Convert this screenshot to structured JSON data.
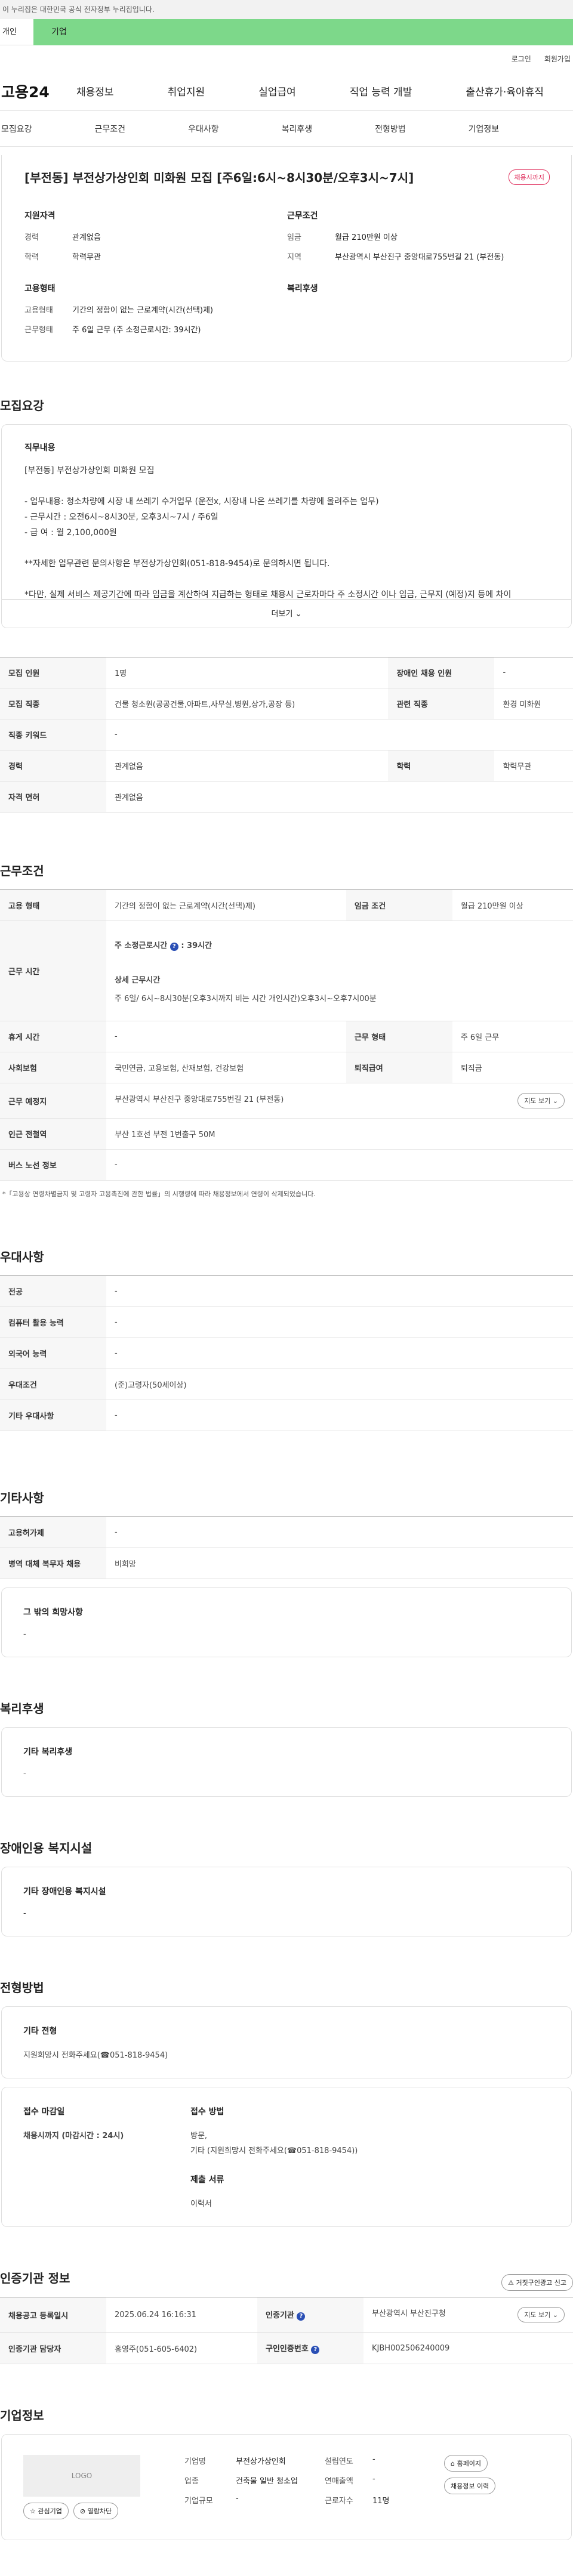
{
  "gov_notice": "이 누리집은 대한민국 공식 전자정부 누리집입니다.",
  "top_tabs": {
    "individual": "개인",
    "company": "기업"
  },
  "util": {
    "login": "로그인",
    "join": "회원가입"
  },
  "logo": "고용24",
  "gnb": [
    "채용정보",
    "취업지원",
    "실업급여",
    "직업 능력 개발",
    "출산휴가·육아휴직"
  ],
  "snb": [
    "모집요강",
    "근무조건",
    "우대사항",
    "복리후생",
    "전형방법",
    "기업정보"
  ],
  "job": {
    "title": "[부전동] 부전상가상인회 미화원 모집 [주6일:6시~8시30분/오후3시~7시]",
    "badge": "채용시까지",
    "qual_title": "지원자격",
    "career_k": "경력",
    "career_v": "관계없음",
    "edu_k": "학력",
    "edu_v": "학력무관",
    "cond_title": "근무조건",
    "wage_k": "임금",
    "wage_v": "월급 210만원 이상",
    "area_k": "지역",
    "area_v": "부산광역시 부산진구 중앙대로755번길 21 (부전동)",
    "emp_title": "고용형태",
    "type_k": "고용형태",
    "type_v": "기간의 정함이 없는 근로계약(시간(선택)제)",
    "form_k": "근무형태",
    "form_v": "주 6일 근무 (주 소정근로시간: 39시간)",
    "welfare_title": "복리후생"
  },
  "recruit": {
    "section_title": "모집요강",
    "desc_label": "직무내용",
    "desc": "[부전동] 부전상가상인회 미화원 모집\n\n- 업무내용: 청소차량에 시장 내 쓰레기 수거업무 (운전x, 시장내 나온 쓰레기를 차량에 올려주는 업무)\n- 근무시간 : 오전6시~8시30분, 오후3시~7시 / 주6일\n- 급       여 : 월 2,100,000원\n\n**자세한 업무관련 문의사항은 부전상가상인회(051-818-9454)로 문의하시면 됩니다.\n\n*다만, 실제 서비스 제공기간에 따라 임금을 계산하여 지급하는 형태로 채용시 근로자마다 주 소정시간 이나 임금, 근무지 (예정)지 등에 차이",
    "more": "더보기",
    "rows": [
      {
        "k1": "모집 인원",
        "v1": "1명",
        "k2": "장애인 채용 인원",
        "v2": "-"
      },
      {
        "k1": "모집 직종",
        "v1": "건물 청소원(공공건물,아파트,사무실,병원,상가,공장 등)",
        "k2": "관련 직종",
        "v2": "환경 미화원"
      },
      {
        "k1": "직종 키워드",
        "v1": "-",
        "k2": "",
        "v2": ""
      },
      {
        "k1": "경력",
        "v1": "관계없음",
        "k2": "학력",
        "v2": "학력무관"
      },
      {
        "k1": "자격 면허",
        "v1": "관계없음",
        "k2": "",
        "v2": ""
      }
    ]
  },
  "work": {
    "section_title": "근무조건",
    "type_k": "고용 형태",
    "type_v": "기간의 정함이 없는 근로계약(시간(선택)제)",
    "wage_k": "임금 조건",
    "wage_v": "월급 210만원 이상",
    "time_k": "근무 시간",
    "time_week": "주 소정근로시간",
    "time_week_v": ": 39시간",
    "time_detail_t": "상세 근무시간",
    "time_detail_v": "주 6일/ 6시~8시30분(오후3시까지 비는 시간 개인시간)오후3시~오후7시00분",
    "rest_k": "휴게 시간",
    "rest_v": "-",
    "form_k": "근무 형태",
    "form_v": "주 6일 근무",
    "ins_k": "사회보험",
    "ins_v": "국민연금, 고용보험, 산재보험, 건강보험",
    "sev_k": "퇴직급여",
    "sev_v": "퇴직금",
    "place_k": "근무 예정지",
    "place_v": "부산광역시 부산진구 중앙대로755번길 21 (부전동)",
    "map_btn": "지도 보기",
    "subway_k": "인근 전철역",
    "subway_v": "부산 1호선 부전 1번출구 50M",
    "bus_k": "버스 노선 정보",
    "bus_v": "-",
    "note": "*「고용상 연령차별금지 및 고령자 고용촉진에 관한 법률」의 시행령에 따라 채용정보에서 연령이 삭제되었습니다."
  },
  "pref": {
    "section_title": "우대사항",
    "rows": [
      {
        "k": "전공",
        "v": "-"
      },
      {
        "k": "컴퓨터 활용 능력",
        "v": "-"
      },
      {
        "k": "외국어 능력",
        "v": "-"
      },
      {
        "k": "우대조건",
        "v": "(준)고령자(50세이상)"
      },
      {
        "k": "기타 우대사항",
        "v": "-"
      }
    ]
  },
  "etc": {
    "section_title": "기타사항",
    "rows": [
      {
        "k": "고용허가제",
        "v": "-"
      },
      {
        "k": "병역 대체 복무자 채용",
        "v": "비희망"
      }
    ],
    "other_title": "그 밖의 희망사항",
    "other_v": "-"
  },
  "welfare": {
    "section_title": "복리후생",
    "box_title": "기타 복리후생",
    "box_v": "-"
  },
  "disab": {
    "section_title": "장애인용 복지시설",
    "box_title": "기타 장애인용 복지시설",
    "box_v": "-"
  },
  "select": {
    "section_title": "전형방법",
    "etc_title": "기타 전형",
    "etc_v": "지원희망시 전화주세요(☎051-818-9454)",
    "deadline_t": "접수 마감일",
    "deadline_v": "채용시까지 (마감시간 : 24시)",
    "method_t": "접수 방법",
    "method_v1": "방문,",
    "method_v2": "기타 (지원희망시 전화주세요(☎051-818-9454))",
    "docs_t": "제출 서류",
    "docs_v": "이력서"
  },
  "agency": {
    "section_title": "인증기관 정보",
    "report_btn": "거짓구인광고 신고",
    "reg_k": "채용공고 등록일시",
    "reg_v": "2025.06.24 16:16:31",
    "org_k": "인증기관",
    "org_v": "부산광역시 부산진구청",
    "map_btn": "지도 보기",
    "mgr_k": "인증기관 담당자",
    "mgr_v": "홍영주(051-605-6402)",
    "num_k": "구인인증번호",
    "num_v": "KJBH002506240009"
  },
  "company": {
    "section_title": "기업정보",
    "logo_text": "LOGO",
    "fav_btn": "관심기업",
    "block_btn": "열람차단",
    "name_k": "기업명",
    "name_v": "부전상가상인회",
    "ind_k": "업종",
    "ind_v": "건축물 일반 청소업",
    "size_k": "기업규모",
    "size_v": "-",
    "year_k": "설립연도",
    "year_v": "-",
    "sales_k": "연매출액",
    "sales_v": "-",
    "emp_k": "근로자수",
    "emp_v": "11명",
    "home_btn": "홈페이지",
    "history_btn": "채용정보 이력"
  }
}
